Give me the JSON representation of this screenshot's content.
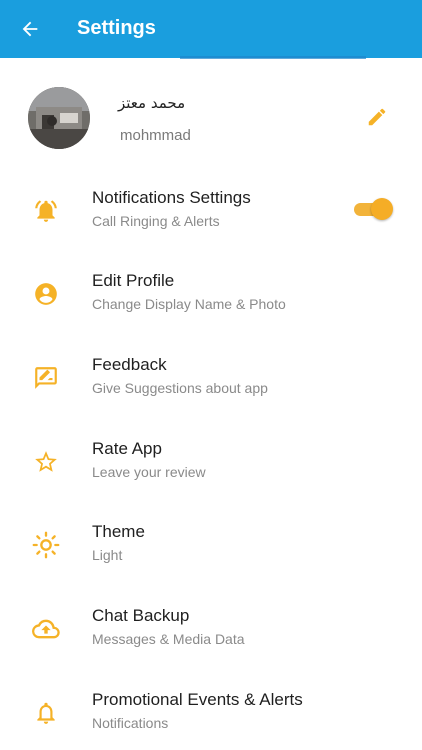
{
  "colors": {
    "appbar": "#1a9ede",
    "accent": "#f5b227",
    "title": "#1f1f1f",
    "subtitle": "#8a8a8a"
  },
  "header": {
    "title": "Settings",
    "back_icon": "arrow-left-icon"
  },
  "profile": {
    "name": "محمد معتز",
    "username": "mohmmad",
    "edit_icon": "pencil-icon"
  },
  "items": [
    {
      "title": "Notifications Settings",
      "subtitle": "Call Ringing & Alerts",
      "icon": "bell-ringing-icon",
      "toggle_on": true
    },
    {
      "title": "Edit Profile",
      "subtitle": "Change Display Name & Photo",
      "icon": "account-circle-icon"
    },
    {
      "title": "Feedback",
      "subtitle": "Give Suggestions about app",
      "icon": "feedback-icon"
    },
    {
      "title": "Rate App",
      "subtitle": "Leave your review",
      "icon": "star-icon"
    },
    {
      "title": "Theme",
      "subtitle": "Light",
      "icon": "sun-icon"
    },
    {
      "title": "Chat Backup",
      "subtitle": "Messages & Media Data",
      "icon": "cloud-upload-icon"
    },
    {
      "title": "Promotional Events & Alerts",
      "subtitle": "Notifications",
      "icon": "bell-icon"
    }
  ]
}
